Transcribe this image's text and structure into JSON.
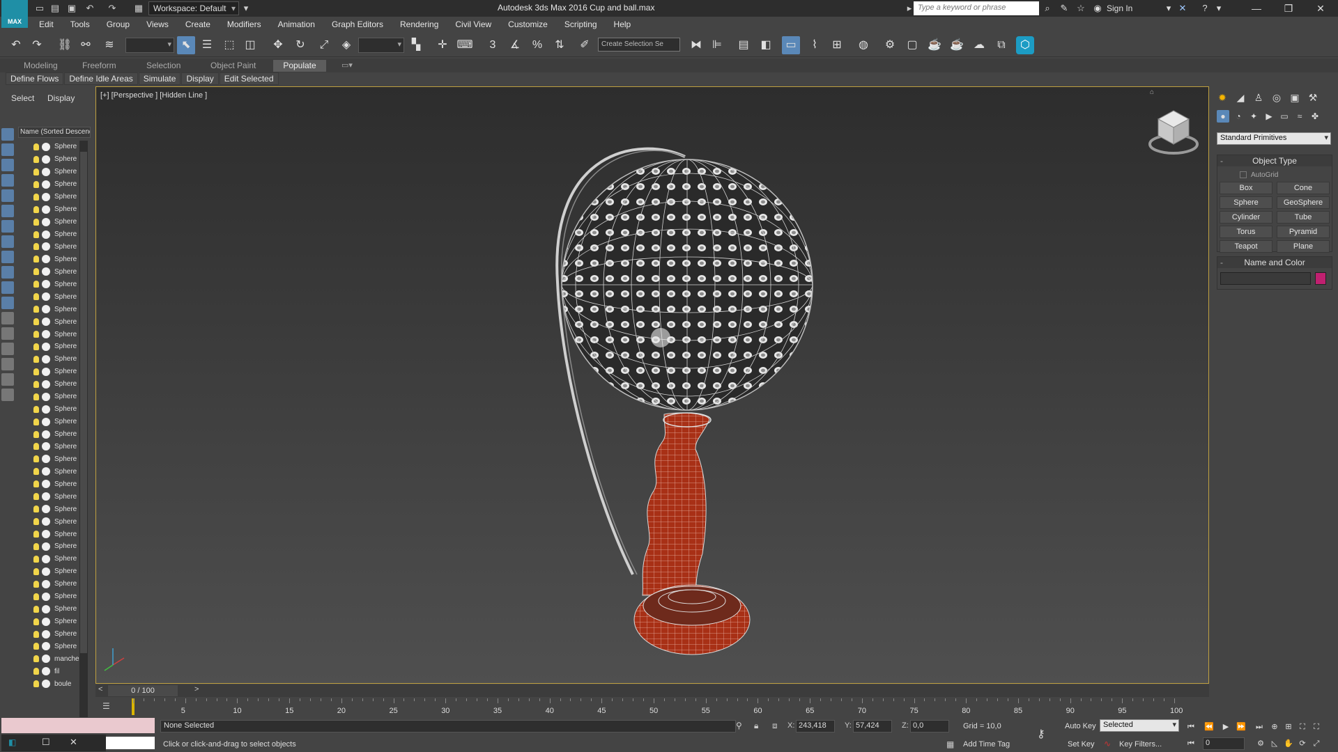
{
  "app": {
    "logo_text": "MAX",
    "workspace": "Workspace: Default",
    "title": "Autodesk 3ds Max 2016    Cup and ball.max",
    "search_placeholder": "Type a keyword or phrase",
    "sign_in": "Sign In"
  },
  "menu": [
    "Edit",
    "Tools",
    "Group",
    "Views",
    "Create",
    "Modifiers",
    "Animation",
    "Graph Editors",
    "Rendering",
    "Civil View",
    "Customize",
    "Scripting",
    "Help"
  ],
  "toolbar": {
    "selection_set_placeholder": "Create Selection Se",
    "snap_label": "3"
  },
  "ribbon": {
    "tabs": [
      "Modeling",
      "Freeform",
      "Selection",
      "Object Paint",
      "Populate"
    ],
    "active_tab": "Populate",
    "sub_buttons": [
      "Define Flows",
      "Define Idle Areas",
      "Simulate",
      "Display",
      "Edit Selected"
    ]
  },
  "explorer": {
    "tabs": [
      "Select",
      "Display"
    ],
    "column_header": "Name (Sorted Descending)",
    "items": [
      "Sphere",
      "Sphere",
      "Sphere",
      "Sphere",
      "Sphere",
      "Sphere",
      "Sphere",
      "Sphere",
      "Sphere",
      "Sphere",
      "Sphere",
      "Sphere",
      "Sphere",
      "Sphere",
      "Sphere",
      "Sphere",
      "Sphere",
      "Sphere",
      "Sphere",
      "Sphere",
      "Sphere",
      "Sphere",
      "Sphere",
      "Sphere",
      "Sphere",
      "Sphere",
      "Sphere",
      "Sphere",
      "Sphere",
      "Sphere",
      "Sphere",
      "Sphere",
      "Sphere",
      "Sphere",
      "Sphere",
      "Sphere",
      "Sphere",
      "Sphere",
      "Sphere",
      "Sphere",
      "Sphere",
      "manche",
      "fil",
      "boule"
    ]
  },
  "viewport": {
    "label": "[+] [Perspective ] [Hidden Line ]",
    "accent_color": "#bfa040",
    "mesh_red": "#b03318",
    "wire_color": "#d8d8d8"
  },
  "command_panel": {
    "category": "Standard Primitives",
    "object_type_title": "Object Type",
    "autogrid": "AutoGrid",
    "primitives": [
      "Box",
      "Cone",
      "Sphere",
      "GeoSphere",
      "Cylinder",
      "Tube",
      "Torus",
      "Pyramid",
      "Teapot",
      "Plane"
    ],
    "name_color_title": "Name and Color",
    "object_color": "#c02070"
  },
  "timeline": {
    "position": "0 / 100",
    "ticks": [
      5,
      10,
      15,
      20,
      25,
      30,
      35,
      40,
      45,
      50,
      55,
      60,
      65,
      70,
      75,
      80,
      85,
      90,
      95,
      100
    ],
    "current_frame": 0
  },
  "status": {
    "selection": "None Selected",
    "prompt": "Click or click-and-drag to select objects",
    "x_label": "X:",
    "x_value": "243,418",
    "y_label": "Y:",
    "y_value": "57,424",
    "z_label": "Z:",
    "z_value": "0,0",
    "grid": "Grid = 10,0",
    "add_time_tag": "Add Time Tag",
    "auto_key": "Auto Key",
    "set_key": "Set Key",
    "key_mode": "Selected",
    "key_filters": "Key Filters...",
    "frame": "0"
  }
}
